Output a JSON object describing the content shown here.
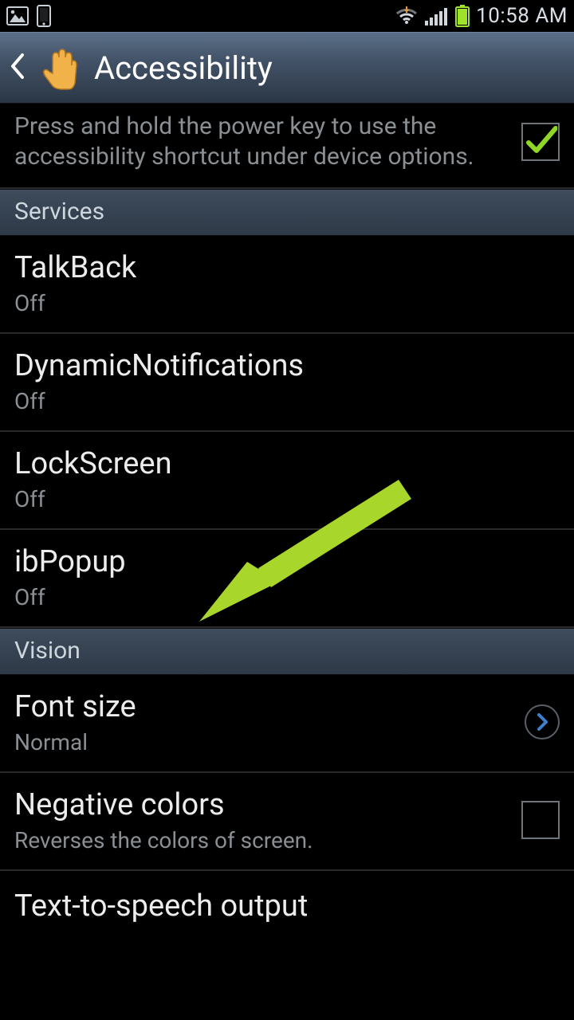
{
  "statusbar": {
    "clock": "10:58 AM"
  },
  "actionbar": {
    "title": "Accessibility"
  },
  "top": {
    "description": "Press and hold the power key to use the accessibility shortcut under device options.",
    "checked": true
  },
  "sections": [
    {
      "header": "Services",
      "items": [
        {
          "title": "TalkBack",
          "sub": "Off"
        },
        {
          "title": "DynamicNotifications",
          "sub": "Off"
        },
        {
          "title": "LockScreen",
          "sub": "Off"
        },
        {
          "title": "ibPopup",
          "sub": "Off"
        }
      ]
    },
    {
      "header": "Vision",
      "items": [
        {
          "title": "Font size",
          "sub": "Normal",
          "accessory": "chevron"
        },
        {
          "title": "Negative colors",
          "sub": "Reverses the colors of screen.",
          "accessory": "checkbox"
        },
        {
          "title": "Text-to-speech output"
        }
      ]
    }
  ],
  "colors": {
    "arrow": "#a9d62a",
    "check": "#8fd626"
  }
}
